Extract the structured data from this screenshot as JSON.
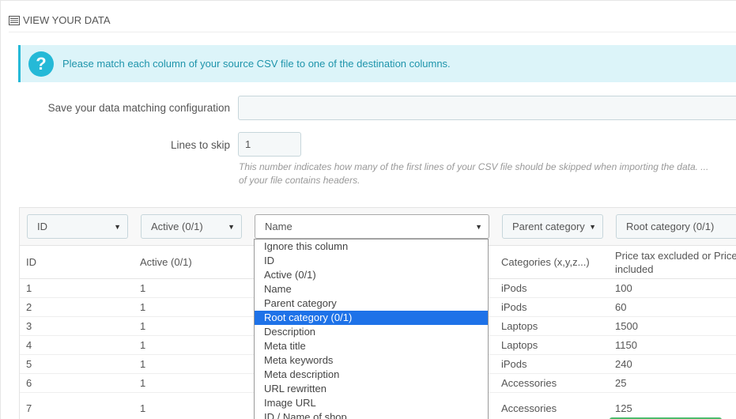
{
  "panel": {
    "title": "VIEW YOUR DATA",
    "icon": "list-icon"
  },
  "alert": {
    "icon": "question-icon",
    "text": "Please match each column of your source CSV file to one of the destination columns."
  },
  "form": {
    "config_label": "Save your data matching configuration",
    "config_value": "",
    "skip_label": "Lines to skip",
    "skip_value": "1",
    "help_line1": "This number indicates how many of the first lines of your CSV file should be skipped when importing the data. ...",
    "help_line2": "of your file contains headers."
  },
  "selectors": [
    {
      "value": "ID"
    },
    {
      "value": "Active (0/1)"
    },
    {
      "value": "Name"
    },
    {
      "value": "Parent category"
    },
    {
      "value": "Root category (0/1)"
    }
  ],
  "table": {
    "headers": [
      "ID",
      "Active (0/1)",
      "",
      "Categories (x,y,z...)",
      "Price tax excluded or Price tax",
      "included"
    ],
    "rows": [
      [
        "1",
        "1",
        "iPods",
        "100"
      ],
      [
        "2",
        "1",
        "iPods",
        "60"
      ],
      [
        "3",
        "1",
        "Laptops",
        "1500"
      ],
      [
        "4",
        "1",
        "Laptops",
        "1150"
      ],
      [
        "5",
        "1",
        "iPods",
        "240"
      ],
      [
        "6",
        "1",
        "Accessories",
        "25"
      ],
      [
        "7",
        "1",
        "Accessories",
        "125"
      ]
    ]
  },
  "dropdown": {
    "options": [
      "Ignore this column",
      "ID",
      "Active (0/1)",
      "Name",
      "Parent category",
      "Root category (0/1)",
      "Description",
      "Meta title",
      "Meta keywords",
      "Meta description",
      "URL rewritten",
      "Image URL",
      "ID / Name of shop"
    ],
    "selected": "Root category (0/1)"
  },
  "colors": {
    "accent": "#25b9d7",
    "alert_bg": "#dcf4f9",
    "selected_option": "#1e72e8",
    "success": "#4cbb6c"
  }
}
